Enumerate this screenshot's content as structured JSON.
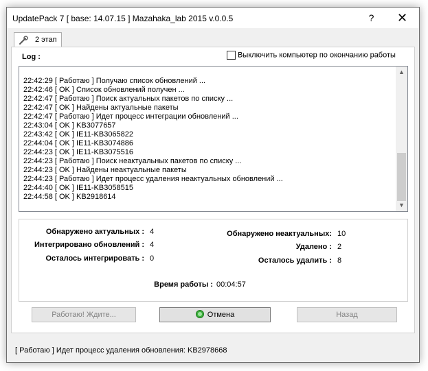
{
  "window": {
    "title": "UpdatePack 7 [ base: 14.07.15 ] Mazahaka_lab 2015 v.0.0.5",
    "help_glyph": "?",
    "close_glyph": "✕"
  },
  "tabs": [
    {
      "label": "2 этап",
      "icon": "wrench-icon"
    }
  ],
  "log": {
    "label": "Log :",
    "shutdown_checkbox_label": "Выключить компьютер по  окончанию работы",
    "shutdown_checked": false,
    "lines": [
      "22:42:29 [ Работаю ] Получаю список обновлений ...",
      "22:42:46 [ OK ] Список обновлений получен ...",
      "22:42:47 [ Работаю ] Поиск актуальных пакетов по списку ...",
      "22:42:47 [ OK ] Найдены актуальные пакеты",
      "22:42:47 [ Работаю ] Идет процесс интеграции обновлений ...",
      "22:43:04 [ OK ] KB3077657",
      "22:43:42 [ OK ] IE11-KB3065822",
      "22:44:04 [ OK ] IE11-KB3074886",
      "22:44:23 [ OK ] IE11-KB3075516",
      "22:44:23 [ Работаю ] Поиск неактуальных пакетов по списку ...",
      "22:44:23 [ OK ] Найдены неактуальные пакеты",
      "22:44:23 [ Работаю ] Идет процесс удаления неактуальных обновлений ...",
      "22:44:40 [ OK ] IE11-KB3058515",
      "22:44:58 [ OK ] KB2918614"
    ],
    "scroll_up_glyph": "▲",
    "scroll_down_glyph": "▼"
  },
  "stats": {
    "found_actual_label": "Обнаружено актуальных :",
    "found_actual_value": "4",
    "integrated_label": "Интегрировано обновлений :",
    "integrated_value": "4",
    "remaining_integrate_label": "Осталось интегрировать :",
    "remaining_integrate_value": "0",
    "found_nonactual_label": "Обнаружено неактуальных:",
    "found_nonactual_value": "10",
    "deleted_label": "Удалено :",
    "deleted_value": "2",
    "remaining_delete_label": "Осталось удалить :",
    "remaining_delete_value": "8",
    "elapsed_label": "Время работы :",
    "elapsed_value": "00:04:57"
  },
  "buttons": {
    "working_label": "Работаю! Ждите...",
    "cancel_label": "Отмена",
    "back_label": "Назад"
  },
  "status": {
    "text": "[ Работаю ] Идет процесс удаления обновления: KB2978668"
  },
  "colors": {
    "cancel_icon": "#3cae3c"
  }
}
